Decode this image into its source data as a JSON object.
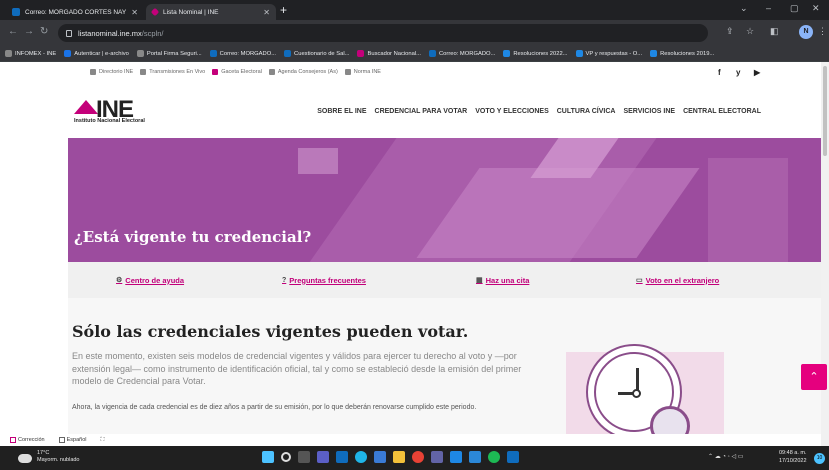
{
  "browser": {
    "tabs": [
      {
        "title": "Correo: MORGADO CORTES NAY",
        "favicon_color": "#0f6cbd"
      },
      {
        "title": "Lista Nominal | INE",
        "favicon_color": "#c4007a"
      }
    ],
    "new_tab": "+",
    "url_host": "listanominal.ine.mx",
    "url_path": "/scpln/",
    "bookmarks": [
      {
        "label": "INFOMEX - INE",
        "icon_color": "#888888"
      },
      {
        "label": "Autenticar | e-archivo",
        "icon_color": "#1a73e8"
      },
      {
        "label": "Portal Firma Seguri...",
        "icon_color": "#888888"
      },
      {
        "label": "Correo: MORGADO...",
        "icon_color": "#0f6cbd"
      },
      {
        "label": "Cuestionario de Sal...",
        "icon_color": "#0f6cbd"
      },
      {
        "label": "Buscador Nacional...",
        "icon_color": "#c4007a"
      },
      {
        "label": "Correo: MORGADO...",
        "icon_color": "#0f6cbd"
      },
      {
        "label": "Resoluciones 2022...",
        "icon_color": "#1e88e5"
      },
      {
        "label": "VP y respuestas - O...",
        "icon_color": "#1e88e5"
      },
      {
        "label": "Resoluciones 2019...",
        "icon_color": "#1e88e5"
      }
    ],
    "profile_initial": "N"
  },
  "page": {
    "util_links": [
      "Directorio INE",
      "Transmisiones En Vivo",
      "Gaceta Electoral",
      "Agenda Consejeros (As)",
      "Norma INE"
    ],
    "social": [
      "f",
      "y",
      "▶"
    ],
    "logo": {
      "mark": "INE",
      "subtitle": "Instituto Nacional Electoral"
    },
    "nav": [
      "SOBRE EL INE",
      "CREDENCIAL PARA VOTAR",
      "VOTO Y ELECCIONES",
      "CULTURA CÍVICA",
      "SERVICIOS INE",
      "CENTRAL ELECTORAL"
    ],
    "hero_title": "¿Está vigente tu credencial?",
    "quick_links": [
      {
        "label": "Centro de ayuda",
        "icon": "⚙"
      },
      {
        "label": "Preguntas frecuentes",
        "icon": "?"
      },
      {
        "label": "Haz una cita",
        "icon": "▦"
      },
      {
        "label": "Voto en el extranjero",
        "icon": "▭"
      }
    ],
    "content_title": "Sólo las credenciales vigentes pueden votar.",
    "content_p1": "En este momento, existen seis modelos de credencial vigentes y válidos para ejercer tu derecho al voto y —por extensión legal— como instrumento de identificación oficial, tal y como se estableció desde la emisión del primer modelo de Credencial para Votar.",
    "content_p2": "Ahora, la vigencia de cada credencial es de diez años a partir de su emisión, por lo que deberán renovarse cumplido este periodo.",
    "translate_bar": [
      "Corrección",
      "Español"
    ]
  },
  "taskbar": {
    "temperature": "17°C",
    "weather": "Mayorm. nublado",
    "time": "09:48 a. m.",
    "date": "17/10/2022",
    "notifications": "10"
  },
  "colors": {
    "brand": "#c4007a",
    "hero": "#9c4c9e",
    "scroll_top": "#e5007e"
  }
}
